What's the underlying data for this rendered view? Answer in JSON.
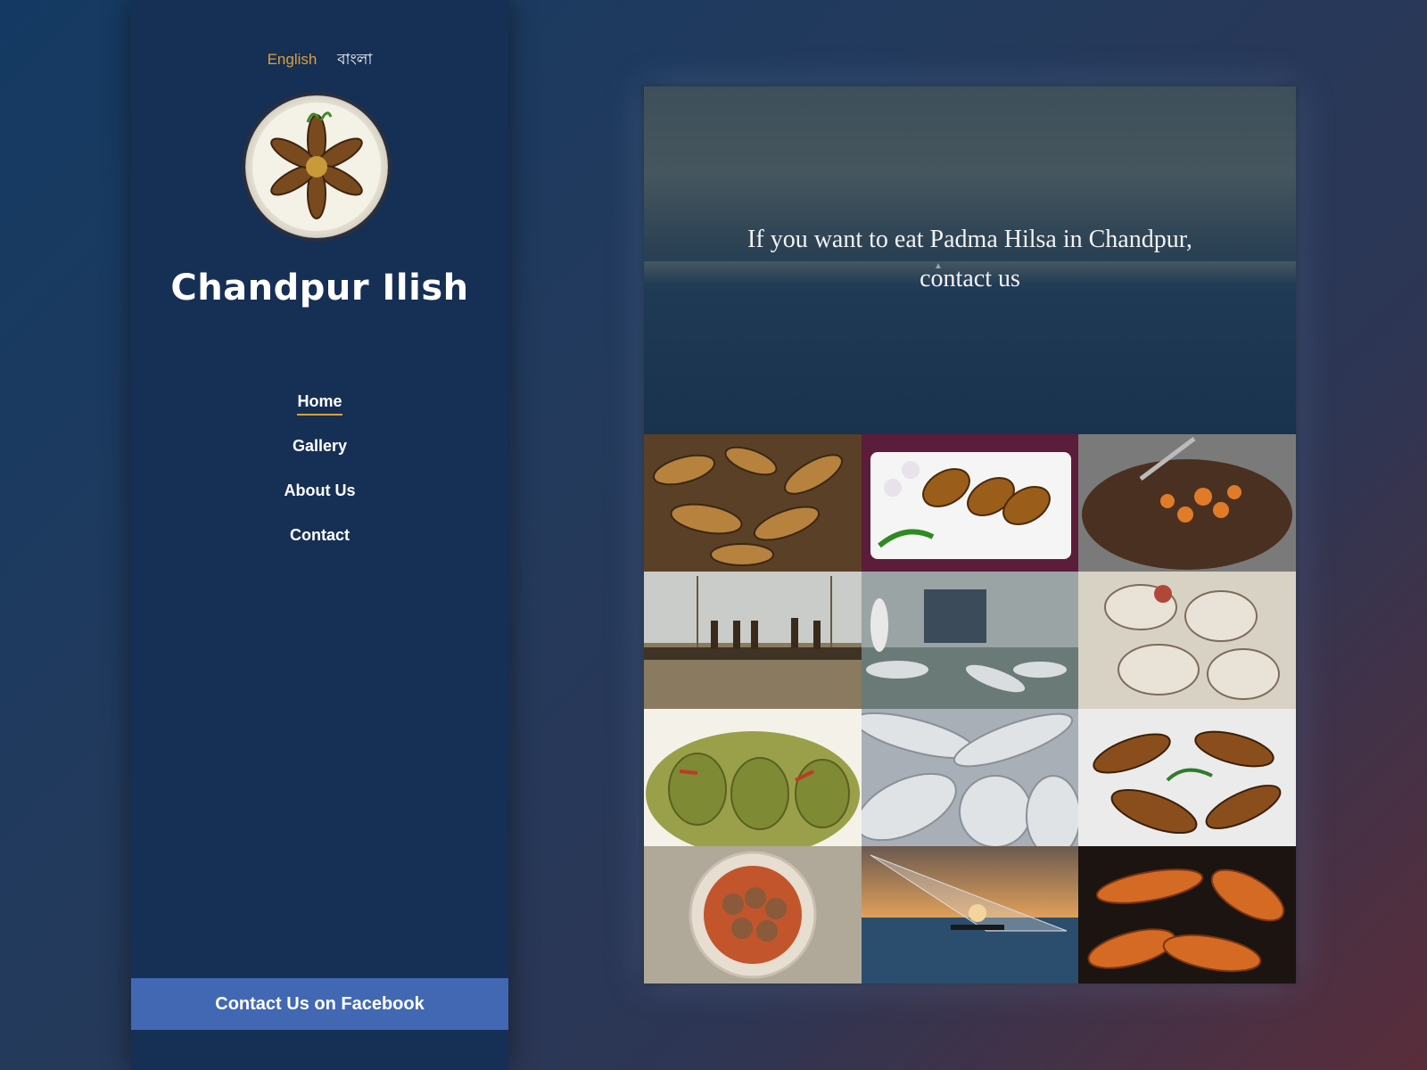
{
  "language": {
    "english": "English",
    "bangla": "বাংলা"
  },
  "brand": {
    "title": "Chandpur Ilish"
  },
  "nav": {
    "items": [
      {
        "label": "Home",
        "active": true
      },
      {
        "label": "Gallery",
        "active": false
      },
      {
        "label": "About Us",
        "active": false
      },
      {
        "label": "Contact",
        "active": false
      }
    ]
  },
  "facebook_button": "Contact Us on Facebook",
  "hero": {
    "line1": "If you want to eat Padma Hilsa in Chandpur,",
    "line2": "contact us"
  },
  "colors": {
    "sidebar": "#162f55",
    "accent": "#d9a23a",
    "facebook": "#4268b3"
  }
}
